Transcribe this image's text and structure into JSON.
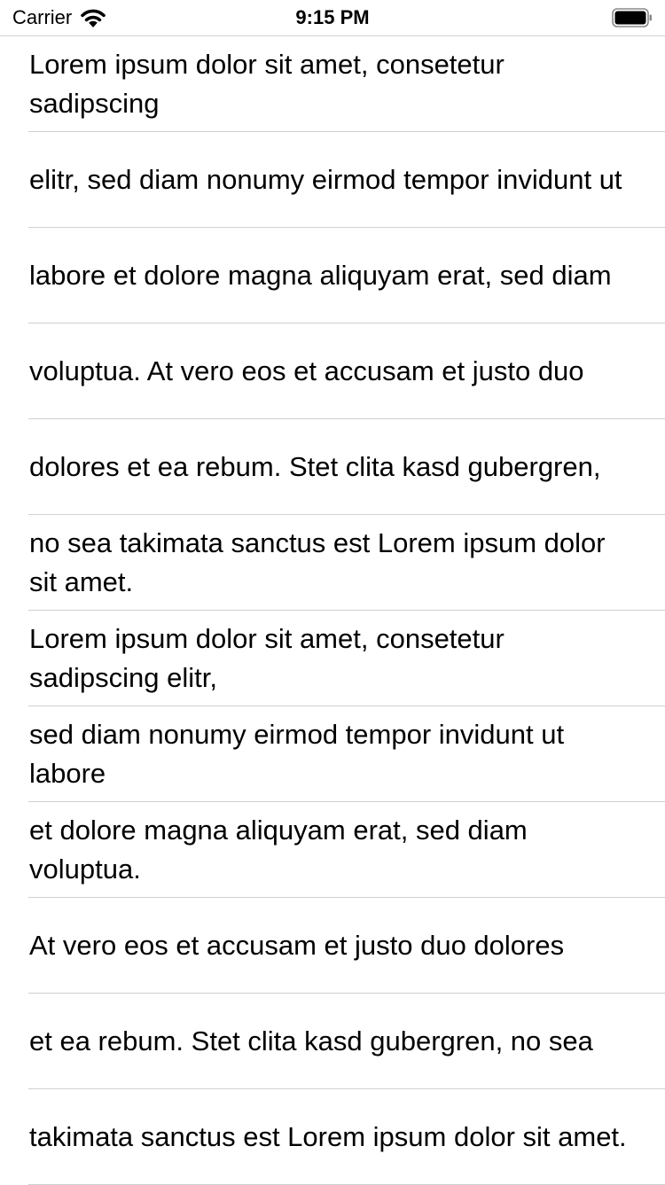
{
  "status_bar": {
    "carrier": "Carrier",
    "time": "9:15 PM",
    "wifi_icon": "wifi-icon",
    "battery_icon": "battery-full-icon"
  },
  "list": {
    "items": [
      "Lorem ipsum dolor sit amet, consetetur sadipscing",
      "elitr, sed diam nonumy eirmod tempor invidunt ut",
      "labore et dolore magna aliquyam erat, sed diam",
      "voluptua. At vero eos et accusam et justo duo",
      "dolores et ea rebum. Stet clita kasd gubergren,",
      "no sea takimata sanctus est Lorem ipsum dolor sit amet.",
      "Lorem ipsum dolor sit amet, consetetur sadipscing elitr,",
      "sed diam nonumy eirmod tempor invidunt ut labore",
      "et dolore magna aliquyam erat, sed diam voluptua.",
      "At vero eos et accusam et justo duo dolores",
      "et ea rebum. Stet clita kasd gubergren, no sea",
      "takimata sanctus est Lorem ipsum dolor sit amet."
    ]
  }
}
